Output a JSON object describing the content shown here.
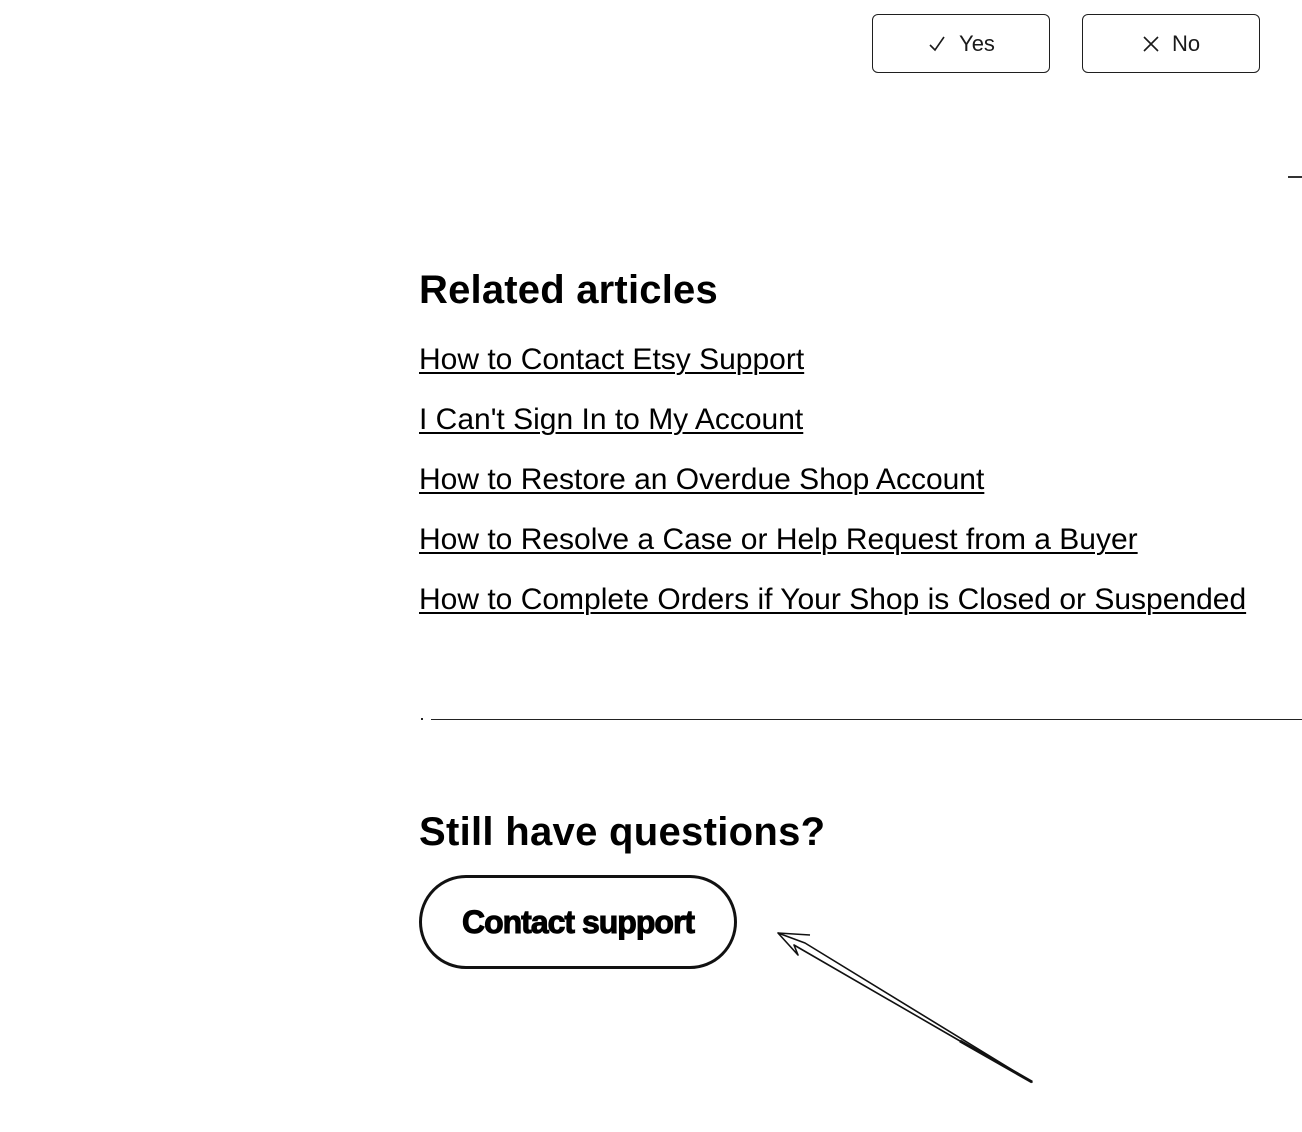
{
  "feedback": {
    "yes": {
      "icon": "check-icon",
      "label": "Yes"
    },
    "no": {
      "icon": "close-icon",
      "label": "No"
    }
  },
  "related": {
    "title": "Related articles",
    "articles": [
      "How to Contact Etsy Support",
      "I Can't Sign In to My Account",
      "How to Restore an Overdue Shop Account",
      "How to Resolve a Case or Help Request from a Buyer",
      "How to Complete Orders if Your Shop is Closed or Suspended"
    ]
  },
  "questions": {
    "title": "Still have questions?",
    "contact_label": "Contact support"
  },
  "annotation": {
    "icon": "pointer-arrow-icon"
  }
}
